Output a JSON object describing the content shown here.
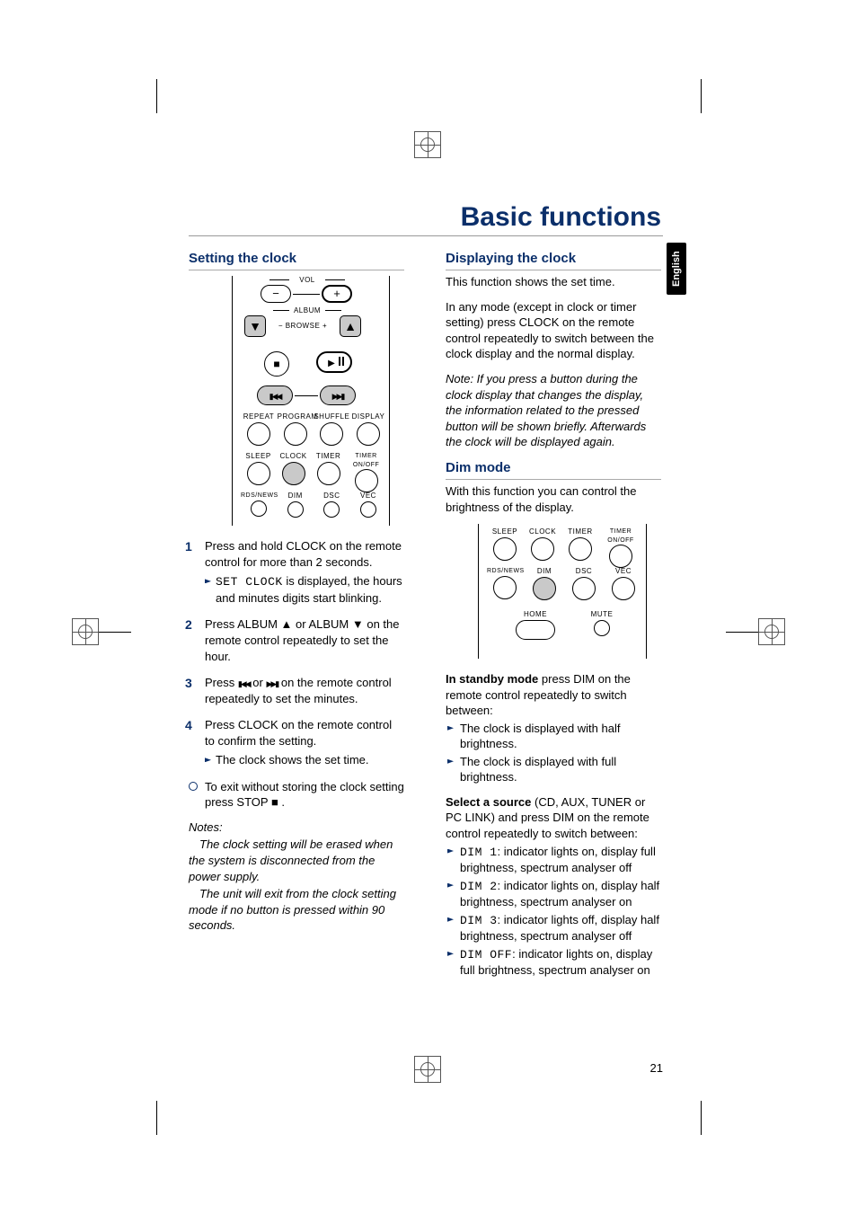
{
  "page_title": "Basic functions",
  "language_tab": "English",
  "page_number": "21",
  "left": {
    "heading": "Setting the clock",
    "remote": {
      "vol": "VOL",
      "album": "ALBUM",
      "browse_minus": "−",
      "browse_label": "BROWSE",
      "browse_plus": "+",
      "row_labels": [
        "REPEAT",
        "PROGRAM",
        "SHUFFLE",
        "DISPLAY"
      ],
      "row2_labels": [
        "SLEEP",
        "CLOCK",
        "TIMER",
        "TIMER ON/OFF"
      ],
      "row3_labels": [
        "RDS/NEWS",
        "DIM",
        "DSC",
        "VEC"
      ]
    },
    "steps": [
      {
        "num": "1",
        "text": "Press and hold CLOCK on the remote control for more than 2 seconds.",
        "sub_code": "SET CLOCK",
        "sub_text": " is displayed, the hours and minutes digits start blinking."
      },
      {
        "num": "2",
        "text_a": "Press ALBUM ",
        "text_b": " or ALBUM ",
        "text_c": " on the remote control repeatedly to set the hour."
      },
      {
        "num": "3",
        "text_a": "Press ",
        "text_b": " or ",
        "text_c": " on the remote control repeatedly to set the minutes."
      },
      {
        "num": "4",
        "text": "Press CLOCK on the remote control to confirm the setting.",
        "sub_text": "The clock shows the set time."
      }
    ],
    "exit_tip_a": "To exit without storing the clock setting press STOP ",
    "exit_tip_b": " .",
    "notes_label": "Notes:",
    "note1": "The clock setting will be erased when the system is disconnected from the power supply.",
    "note2": "The unit will exit from the clock setting mode if no button is pressed within 90 seconds."
  },
  "right": {
    "display_head": "Displaying the clock",
    "display_p1": "This function shows the set time.",
    "display_p2": "In any mode (except in clock or timer setting) press CLOCK on the remote control repeatedly to switch between the clock display and the normal display.",
    "display_note": "Note: If you press a button during the clock display that changes the display, the information related to the pressed button will be shown briefly. Afterwards the clock will be displayed again.",
    "dim_head": "Dim mode",
    "dim_p1": "With this function you can control the brightness of the display.",
    "remote": {
      "row2_labels": [
        "SLEEP",
        "CLOCK",
        "TIMER",
        "TIMER ON/OFF"
      ],
      "row3_labels": [
        "RDS/NEWS",
        "DIM",
        "DSC",
        "VEC"
      ],
      "row4_labels": [
        "HOME",
        "MUTE"
      ]
    },
    "standby_lead": "In standby mode",
    "standby_rest": " press DIM on the remote control repeatedly to switch between:",
    "standby_opts": [
      "The clock is displayed with half brightness.",
      "The clock is displayed with full brightness."
    ],
    "source_lead": "Select a source",
    "source_rest": " (CD, AUX, TUNER or PC LINK) and press DIM on the remote control repeatedly to switch between:",
    "dim_opts": [
      {
        "code": "DIM 1",
        "text": ": indicator lights on, display full brightness, spectrum analyser off"
      },
      {
        "code": "DIM 2",
        "text": ": indicator lights on, display half brightness, spectrum analyser on"
      },
      {
        "code": "DIM 3",
        "text": ": indicator lights off, display half brightness, spectrum analyser off"
      },
      {
        "code": "DIM OFF",
        "text": ": indicator lights on, display full brightness, spectrum analyser on"
      }
    ]
  }
}
